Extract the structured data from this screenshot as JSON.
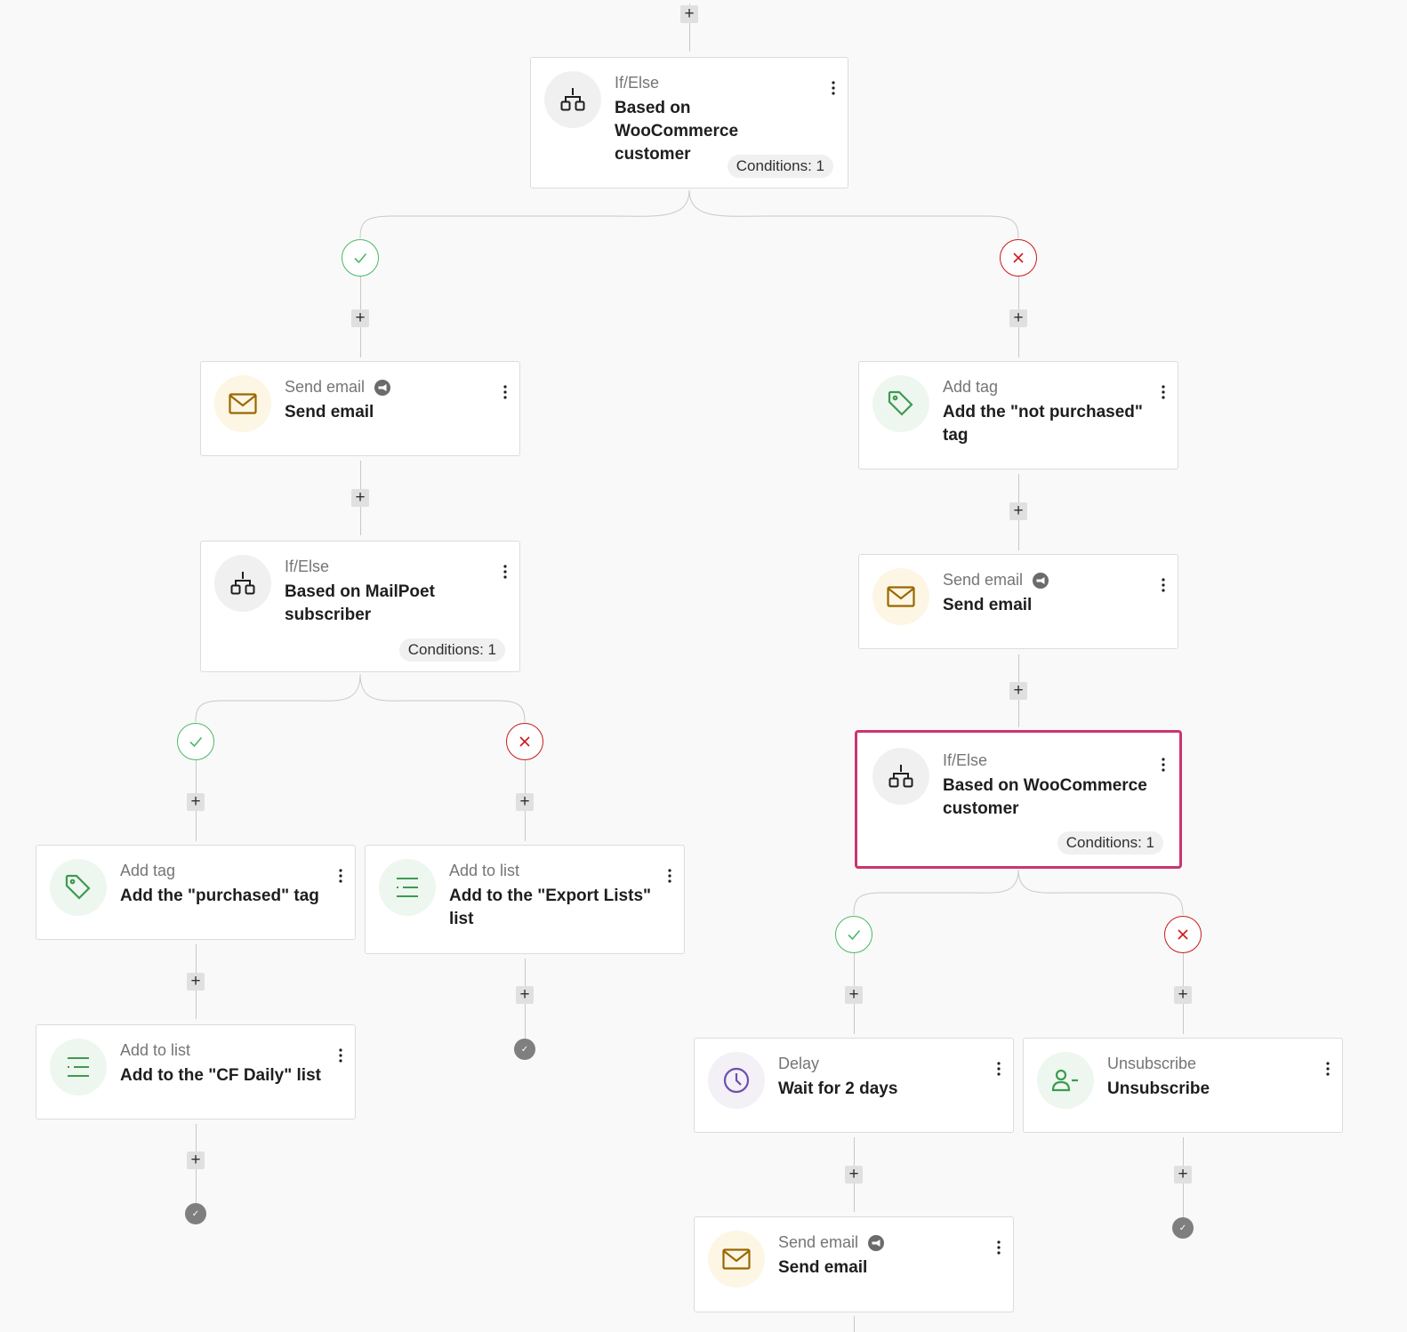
{
  "colors": {
    "connector": "#c8c8c8",
    "yes": "#4ab866",
    "no": "#cc1818",
    "selected_border": "#c9356e",
    "email_icon": "#996800",
    "tag_icon": "#3e9a4f",
    "delay_icon": "#6e4fb0"
  },
  "add_step_symbol": "+",
  "end_symbol": "✓",
  "steps": {
    "ifelse_woo_top": {
      "type": "If/Else",
      "title": "Based on WooCommerce customer",
      "badge": "Conditions: 1",
      "icon": "branch-icon"
    },
    "send_email_yes": {
      "type": "Send email",
      "title": "Send email",
      "icon": "envelope-icon"
    },
    "ifelse_mailpoet": {
      "type": "If/Else",
      "title": "Based on MailPoet subscriber",
      "badge": "Conditions: 1",
      "icon": "branch-icon"
    },
    "add_tag_purchased": {
      "type": "Add tag",
      "title": "Add the \"purchased\" tag",
      "icon": "tag-icon"
    },
    "add_list_cf_daily": {
      "type": "Add to list",
      "title": "Add to the \"CF Daily\" list",
      "icon": "list-icon"
    },
    "add_list_export": {
      "type": "Add to list",
      "title": "Add to the \"Export Lists\" list",
      "icon": "list-icon"
    },
    "add_tag_not_purchased": {
      "type": "Add tag",
      "title": "Add the \"not purchased\" tag",
      "icon": "tag-icon"
    },
    "send_email_no": {
      "type": "Send email",
      "title": "Send email",
      "icon": "envelope-icon"
    },
    "ifelse_woo_selected": {
      "type": "If/Else",
      "title": "Based on WooCommerce customer",
      "badge": "Conditions: 1",
      "icon": "branch-icon"
    },
    "delay": {
      "type": "Delay",
      "title": "Wait for 2 days",
      "icon": "clock-icon"
    },
    "unsubscribe": {
      "type": "Unsubscribe",
      "title": "Unsubscribe",
      "icon": "user-minus-icon"
    },
    "send_email_final": {
      "type": "Send email",
      "title": "Send email",
      "icon": "envelope-icon"
    }
  }
}
